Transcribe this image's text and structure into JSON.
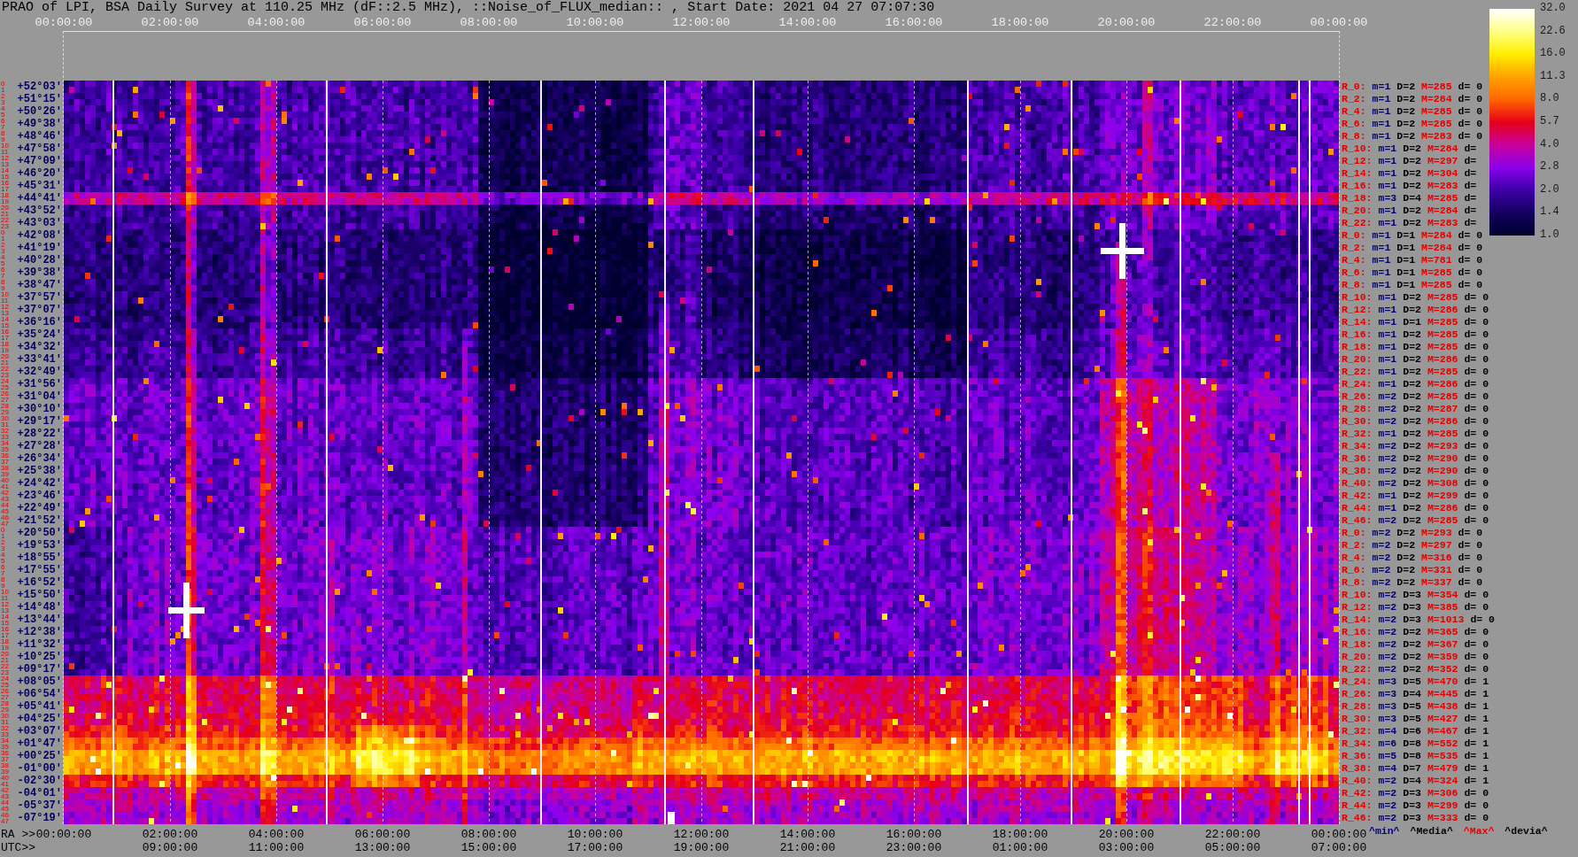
{
  "title": "PRAO of LPI, BSA Daily Survey at 110.25 MHz (dF::2.5 MHz), ::Noise_of_FLUX_median:: , Start Date: 2021 04 27 07:07:30",
  "top_axis": {
    "ticks": [
      "00:00:00",
      "02:00:00",
      "04:00:00",
      "06:00:00",
      "08:00:00",
      "10:00:00",
      "12:00:00",
      "14:00:00",
      "16:00:00",
      "18:00:00",
      "20:00:00",
      "22:00:00",
      "00:00:00"
    ]
  },
  "rows": [
    {
      "beams": [
        "0",
        "1"
      ],
      "declination": "+52°03'",
      "label": "R_0:",
      "min": "m=1",
      "median": "D=2",
      "max": "M=285",
      "dev": "d= 0"
    },
    {
      "beams": [
        "2",
        "3"
      ],
      "declination": "+51°15'",
      "label": "R_2:",
      "min": "m=1",
      "median": "D=2",
      "max": "M=284",
      "dev": "d= 0"
    },
    {
      "beams": [
        "4",
        "5"
      ],
      "declination": "+50°26'",
      "label": "R_4:",
      "min": "m=1",
      "median": "D=2",
      "max": "M=285",
      "dev": "d= 0"
    },
    {
      "beams": [
        "6",
        "7"
      ],
      "declination": "+49°38'",
      "label": "R_6:",
      "min": "m=1",
      "median": "D=2",
      "max": "M=285",
      "dev": "d= 0"
    },
    {
      "beams": [
        "8",
        "9"
      ],
      "declination": "+48°46'",
      "label": "R_8:",
      "min": "m=1",
      "median": "D=2",
      "max": "M=283",
      "dev": "d= 0"
    },
    {
      "beams": [
        "10",
        "11"
      ],
      "declination": "+47°58'",
      "label": "R_10:",
      "min": "m=1",
      "median": "D=2",
      "max": "M=284",
      "dev": "d="
    },
    {
      "beams": [
        "12",
        "13"
      ],
      "declination": "+47°09'",
      "label": "R_12:",
      "min": "m=1",
      "median": "D=2",
      "max": "M=297",
      "dev": "d="
    },
    {
      "beams": [
        "14",
        "15"
      ],
      "declination": "+46°20'",
      "label": "R_14:",
      "min": "m=1",
      "median": "D=2",
      "max": "M=304",
      "dev": "d="
    },
    {
      "beams": [
        "16",
        "17"
      ],
      "declination": "+45°31'",
      "label": "R_16:",
      "min": "m=1",
      "median": "D=2",
      "max": "M=283",
      "dev": "d="
    },
    {
      "beams": [
        "18",
        "19"
      ],
      "declination": "+44°41'",
      "label": "R_18:",
      "min": "m=3",
      "median": "D=4",
      "max": "M=285",
      "dev": "d="
    },
    {
      "beams": [
        "20",
        "21"
      ],
      "declination": "+43°52'",
      "label": "R_20:",
      "min": "m=1",
      "median": "D=2",
      "max": "M=284",
      "dev": "d="
    },
    {
      "beams": [
        "22",
        "23"
      ],
      "declination": "+43°03'",
      "label": "R_22:",
      "min": "m=1",
      "median": "D=2",
      "max": "M=283",
      "dev": "d="
    },
    {
      "beams": [
        "0",
        "1"
      ],
      "declination": "+42°08'",
      "label": "R_0:",
      "min": "m=1",
      "median": "D=1",
      "max": "M=284",
      "dev": "d= 0"
    },
    {
      "beams": [
        "2",
        "3"
      ],
      "declination": "+41°19'",
      "label": "R_2:",
      "min": "m=1",
      "median": "D=1",
      "max": "M=284",
      "dev": "d= 0"
    },
    {
      "beams": [
        "4",
        "5"
      ],
      "declination": "+40°28'",
      "label": "R_4:",
      "min": "m=1",
      "median": "D=1",
      "max": "M=781",
      "dev": "d= 0"
    },
    {
      "beams": [
        "6",
        "7"
      ],
      "declination": "+39°38'",
      "label": "R_6:",
      "min": "m=1",
      "median": "D=1",
      "max": "M=285",
      "dev": "d= 0"
    },
    {
      "beams": [
        "8",
        "9"
      ],
      "declination": "+38°47'",
      "label": "R_8:",
      "min": "m=1",
      "median": "D=1",
      "max": "M=285",
      "dev": "d= 0"
    },
    {
      "beams": [
        "10",
        "11"
      ],
      "declination": "+37°57'",
      "label": "R_10:",
      "min": "m=1",
      "median": "D=2",
      "max": "M=285",
      "dev": "d= 0"
    },
    {
      "beams": [
        "12",
        "13"
      ],
      "declination": "+37°07'",
      "label": "R_12:",
      "min": "m=1",
      "median": "D=2",
      "max": "M=286",
      "dev": "d= 0"
    },
    {
      "beams": [
        "14",
        "15"
      ],
      "declination": "+36°16'",
      "label": "R_14:",
      "min": "m=1",
      "median": "D=1",
      "max": "M=285",
      "dev": "d= 0"
    },
    {
      "beams": [
        "16",
        "17"
      ],
      "declination": "+35°24'",
      "label": "R_16:",
      "min": "m=1",
      "median": "D=2",
      "max": "M=285",
      "dev": "d= 0"
    },
    {
      "beams": [
        "18",
        "19"
      ],
      "declination": "+34°32'",
      "label": "R_18:",
      "min": "m=1",
      "median": "D=2",
      "max": "M=285",
      "dev": "d= 0"
    },
    {
      "beams": [
        "20",
        "21"
      ],
      "declination": "+33°41'",
      "label": "R_20:",
      "min": "m=1",
      "median": "D=2",
      "max": "M=286",
      "dev": "d= 0"
    },
    {
      "beams": [
        "22",
        "23"
      ],
      "declination": "+32°49'",
      "label": "R_22:",
      "min": "m=1",
      "median": "D=2",
      "max": "M=285",
      "dev": "d= 0"
    },
    {
      "beams": [
        "24",
        "25"
      ],
      "declination": "+31°56'",
      "label": "R_24:",
      "min": "m=1",
      "median": "D=2",
      "max": "M=286",
      "dev": "d= 0"
    },
    {
      "beams": [
        "26",
        "27"
      ],
      "declination": "+31°04'",
      "label": "R_26:",
      "min": "m=2",
      "median": "D=2",
      "max": "M=285",
      "dev": "d= 0"
    },
    {
      "beams": [
        "28",
        "29"
      ],
      "declination": "+30°10'",
      "label": "R_28:",
      "min": "m=2",
      "median": "D=2",
      "max": "M=287",
      "dev": "d= 0"
    },
    {
      "beams": [
        "30",
        "31"
      ],
      "declination": "+29°17'",
      "label": "R_30:",
      "min": "m=2",
      "median": "D=2",
      "max": "M=286",
      "dev": "d= 0"
    },
    {
      "beams": [
        "32",
        "33"
      ],
      "declination": "+28°22'",
      "label": "R_32:",
      "min": "m=1",
      "median": "D=2",
      "max": "M=285",
      "dev": "d= 0"
    },
    {
      "beams": [
        "34",
        "35"
      ],
      "declination": "+27°28'",
      "label": "R_34:",
      "min": "m=2",
      "median": "D=2",
      "max": "M=293",
      "dev": "d= 0"
    },
    {
      "beams": [
        "36",
        "37"
      ],
      "declination": "+26°34'",
      "label": "R_36:",
      "min": "m=2",
      "median": "D=2",
      "max": "M=290",
      "dev": "d= 0"
    },
    {
      "beams": [
        "38",
        "39"
      ],
      "declination": "+25°38'",
      "label": "R_38:",
      "min": "m=2",
      "median": "D=2",
      "max": "M=290",
      "dev": "d= 0"
    },
    {
      "beams": [
        "40",
        "41"
      ],
      "declination": "+24°42'",
      "label": "R_40:",
      "min": "m=2",
      "median": "D=2",
      "max": "M=308",
      "dev": "d= 0"
    },
    {
      "beams": [
        "42",
        "43"
      ],
      "declination": "+23°46'",
      "label": "R_42:",
      "min": "m=1",
      "median": "D=2",
      "max": "M=299",
      "dev": "d= 0"
    },
    {
      "beams": [
        "44",
        "45"
      ],
      "declination": "+22°49'",
      "label": "R_44:",
      "min": "m=1",
      "median": "D=2",
      "max": "M=286",
      "dev": "d= 0"
    },
    {
      "beams": [
        "46",
        "47"
      ],
      "declination": "+21°52'",
      "label": "R_46:",
      "min": "m=2",
      "median": "D=2",
      "max": "M=285",
      "dev": "d= 0"
    },
    {
      "beams": [
        "0",
        "1"
      ],
      "declination": "+20°50'",
      "label": "R_0:",
      "min": "m=2",
      "median": "D=2",
      "max": "M=293",
      "dev": "d= 0"
    },
    {
      "beams": [
        "2",
        "3"
      ],
      "declination": "+19°53'",
      "label": "R_2:",
      "min": "m=2",
      "median": "D=2",
      "max": "M=297",
      "dev": "d= 0"
    },
    {
      "beams": [
        "4",
        "5"
      ],
      "declination": "+18°55'",
      "label": "R_4:",
      "min": "m=2",
      "median": "D=2",
      "max": "M=316",
      "dev": "d= 0"
    },
    {
      "beams": [
        "6",
        "7"
      ],
      "declination": "+17°55'",
      "label": "R_6:",
      "min": "m=2",
      "median": "D=2",
      "max": "M=331",
      "dev": "d= 0"
    },
    {
      "beams": [
        "8",
        "9"
      ],
      "declination": "+16°52'",
      "label": "R_8:",
      "min": "m=2",
      "median": "D=2",
      "max": "M=337",
      "dev": "d= 0"
    },
    {
      "beams": [
        "10",
        "11"
      ],
      "declination": "+15°50'",
      "label": "R_10:",
      "min": "m=2",
      "median": "D=3",
      "max": "M=354",
      "dev": "d= 0"
    },
    {
      "beams": [
        "12",
        "13"
      ],
      "declination": "+14°48'",
      "label": "R_12:",
      "min": "m=2",
      "median": "D=3",
      "max": "M=385",
      "dev": "d= 0"
    },
    {
      "beams": [
        "14",
        "15"
      ],
      "declination": "+13°44'",
      "label": "R_14:",
      "min": "m=2",
      "median": "D=3",
      "max": "M=1013",
      "dev": "d= 0"
    },
    {
      "beams": [
        "16",
        "17"
      ],
      "declination": "+12°38'",
      "label": "R_16:",
      "min": "m=2",
      "median": "D=2",
      "max": "M=365",
      "dev": "d= 0"
    },
    {
      "beams": [
        "18",
        "19"
      ],
      "declination": "+11°32'",
      "label": "R_18:",
      "min": "m=2",
      "median": "D=2",
      "max": "M=367",
      "dev": "d= 0"
    },
    {
      "beams": [
        "20",
        "21"
      ],
      "declination": "+10°25'",
      "label": "R_20:",
      "min": "m=2",
      "median": "D=2",
      "max": "M=359",
      "dev": "d= 0"
    },
    {
      "beams": [
        "22",
        "23"
      ],
      "declination": "+09°17'",
      "label": "R_22:",
      "min": "m=2",
      "median": "D=2",
      "max": "M=352",
      "dev": "d= 0"
    },
    {
      "beams": [
        "24",
        "25"
      ],
      "declination": "+08°05'",
      "label": "R_24:",
      "min": "m=3",
      "median": "D=5",
      "max": "M=470",
      "dev": "d= 1"
    },
    {
      "beams": [
        "26",
        "27"
      ],
      "declination": "+06°54'",
      "label": "R_26:",
      "min": "m=3",
      "median": "D=4",
      "max": "M=445",
      "dev": "d= 1"
    },
    {
      "beams": [
        "28",
        "29"
      ],
      "declination": "+05°41'",
      "label": "R_28:",
      "min": "m=3",
      "median": "D=5",
      "max": "M=438",
      "dev": "d= 1"
    },
    {
      "beams": [
        "30",
        "31"
      ],
      "declination": "+04°25'",
      "label": "R_30:",
      "min": "m=3",
      "median": "D=5",
      "max": "M=427",
      "dev": "d= 1"
    },
    {
      "beams": [
        "32",
        "33"
      ],
      "declination": "+03°07'",
      "label": "R_32:",
      "min": "m=4",
      "median": "D=6",
      "max": "M=467",
      "dev": "d= 1"
    },
    {
      "beams": [
        "34",
        "35"
      ],
      "declination": "+01°47'",
      "label": "R_34:",
      "min": "m=6",
      "median": "D=8",
      "max": "M=552",
      "dev": "d= 1"
    },
    {
      "beams": [
        "36",
        "37"
      ],
      "declination": "+00°25'",
      "label": "R_36:",
      "min": "m=5",
      "median": "D=8",
      "max": "M=535",
      "dev": "d= 1"
    },
    {
      "beams": [
        "38",
        "39"
      ],
      "declination": "-01°00'",
      "label": "R_38:",
      "min": "m=4",
      "median": "D=7",
      "max": "M=479",
      "dev": "d= 1"
    },
    {
      "beams": [
        "40",
        "41"
      ],
      "declination": "-02°30'",
      "label": "R_40:",
      "min": "m=2",
      "median": "D=4",
      "max": "M=324",
      "dev": "d= 1"
    },
    {
      "beams": [
        "42",
        "43"
      ],
      "declination": "-04°01'",
      "label": "R_42:",
      "min": "m=2",
      "median": "D=3",
      "max": "M=306",
      "dev": "d= 0"
    },
    {
      "beams": [
        "44",
        "45"
      ],
      "declination": "-05°37'",
      "label": "R_44:",
      "min": "m=2",
      "median": "D=3",
      "max": "M=299",
      "dev": "d= 0"
    },
    {
      "beams": [
        "46",
        "47"
      ],
      "declination": "-07°19'",
      "label": "R_46:",
      "min": "m=2",
      "median": "D=3",
      "max": "M=333",
      "dev": "d= 0"
    }
  ],
  "colorbar": {
    "ticks": [
      "32.0",
      "22.6",
      "16.0",
      "11.3",
      "8.0",
      "5.7",
      "4.0",
      "2.8",
      "2.0",
      "1.4",
      "1.0"
    ]
  },
  "bottom_axis": {
    "ra_title": "RA >>",
    "ra_ticks": [
      "00:00:00",
      "02:00:00",
      "04:00:00",
      "06:00:00",
      "08:00:00",
      "10:00:00",
      "12:00:00",
      "14:00:00",
      "16:00:00",
      "18:00:00",
      "20:00:00",
      "22:00:00",
      "00:00:00"
    ],
    "utc_title": "UTC>>",
    "utc_ticks": [
      "09:00:00",
      "11:00:00",
      "13:00:00",
      "15:00:00",
      "17:00:00",
      "19:00:00",
      "21:00:00",
      "23:00:00",
      "01:00:00",
      "03:00:00",
      "05:00:00",
      "07:00:00"
    ]
  },
  "legend": [
    {
      "text": "^min^",
      "kind": "min"
    },
    {
      "text": "^Media^",
      "kind": "median"
    },
    {
      "text": "^Max^",
      "kind": "max"
    },
    {
      "text": "^devia^",
      "kind": "deviation"
    }
  ]
}
